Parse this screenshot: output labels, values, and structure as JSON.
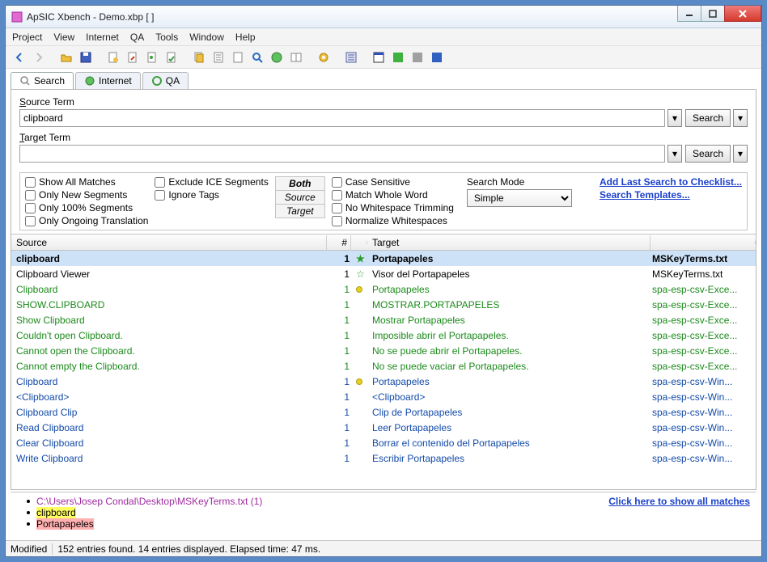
{
  "title": "ApSIC Xbench - Demo.xbp [                            ]",
  "menu": [
    "Project",
    "View",
    "Internet",
    "QA",
    "Tools",
    "Window",
    "Help"
  ],
  "tabs": [
    {
      "label": "Search",
      "active": true,
      "icon": "search-icon"
    },
    {
      "label": "Internet",
      "active": false,
      "icon": "globe-icon"
    },
    {
      "label": "QA",
      "active": false,
      "icon": "qa-icon"
    }
  ],
  "source_label": "Source Term",
  "source_value": "clipboard",
  "target_label": "Target Term",
  "target_value": "",
  "search_btn": "Search",
  "opts_left": [
    "Show All Matches",
    "Only New Segments",
    "Only 100% Segments",
    "Only Ongoing Translation"
  ],
  "opts_mid": [
    "Exclude ICE Segments",
    "Ignore Tags"
  ],
  "mode_btns": [
    "Both",
    "Source",
    "Target"
  ],
  "opts_right": [
    "Case Sensitive",
    "Match Whole Word",
    "No Whitespace Trimming",
    "Normalize Whitespaces"
  ],
  "search_mode_label": "Search Mode",
  "search_mode_value": "Simple",
  "link_checklist": "Add Last Search to Checklist...",
  "link_templates": "Search Templates...",
  "headers": {
    "source": "Source",
    "num": "#",
    "target": "Target"
  },
  "rows": [
    {
      "src": "clipboard",
      "num": "1",
      "icon": "star",
      "tgt": "Portapapeles",
      "file": "MSKeyTerms.txt",
      "cls": "clr-black",
      "sel": true
    },
    {
      "src": "Clipboard Viewer",
      "num": "1",
      "icon": "star-o",
      "tgt": "Visor del Portapapeles",
      "file": "MSKeyTerms.txt",
      "cls": "clr-black"
    },
    {
      "src": "Clipboard",
      "num": "1",
      "icon": "dot",
      "tgt": "Portapapeles",
      "file": "spa-esp-csv-Exce...",
      "cls": "clr-green"
    },
    {
      "src": "SHOW.CLIPBOARD",
      "num": "1",
      "icon": "",
      "tgt": "MOSTRAR.PORTAPAPELES",
      "file": "spa-esp-csv-Exce...",
      "cls": "clr-green"
    },
    {
      "src": "Show Clipboard",
      "num": "1",
      "icon": "",
      "tgt": "Mostrar Portapapeles",
      "file": "spa-esp-csv-Exce...",
      "cls": "clr-green"
    },
    {
      "src": "Couldn't open Clipboard.",
      "num": "1",
      "icon": "",
      "tgt": "Imposible abrir el Portapapeles.",
      "file": "spa-esp-csv-Exce...",
      "cls": "clr-green"
    },
    {
      "src": "Cannot open the Clipboard.",
      "num": "1",
      "icon": "",
      "tgt": "No se puede abrir el Portapapeles.",
      "file": "spa-esp-csv-Exce...",
      "cls": "clr-green"
    },
    {
      "src": "Cannot empty the Clipboard.",
      "num": "1",
      "icon": "",
      "tgt": "No se puede vaciar el Portapapeles.",
      "file": "spa-esp-csv-Exce...",
      "cls": "clr-green"
    },
    {
      "src": "Clipboard",
      "num": "1",
      "icon": "dot",
      "tgt": "Portapapeles",
      "file": "spa-esp-csv-Win...",
      "cls": "clr-blue"
    },
    {
      "src": "<Clipboard>",
      "num": "1",
      "icon": "",
      "tgt": "<Clipboard>",
      "file": "spa-esp-csv-Win...",
      "cls": "clr-blue"
    },
    {
      "src": "Clipboard Clip",
      "num": "1",
      "icon": "",
      "tgt": "Clip de Portapapeles",
      "file": "spa-esp-csv-Win...",
      "cls": "clr-blue"
    },
    {
      "src": "Read Clipboard",
      "num": "1",
      "icon": "",
      "tgt": "Leer Portapapeles",
      "file": "spa-esp-csv-Win...",
      "cls": "clr-blue"
    },
    {
      "src": "Clear Clipboard",
      "num": "1",
      "icon": "",
      "tgt": "Borrar el contenido del Portapapeles",
      "file": "spa-esp-csv-Win...",
      "cls": "clr-blue"
    },
    {
      "src": "Write Clipboard",
      "num": "1",
      "icon": "",
      "tgt": "Escribir Portapapeles",
      "file": "spa-esp-csv-Win...",
      "cls": "clr-blue"
    }
  ],
  "bottom": {
    "path": "C:\\Users\\Josep Condal\\Desktop\\MSKeyTerms.txt (1)",
    "src": "clipboard",
    "tgt": "Portapapeles",
    "link": "Click here to show all matches"
  },
  "status": {
    "modified": "Modified",
    "msg": "152 entries found. 14 entries displayed. Elapsed time: 47 ms."
  }
}
